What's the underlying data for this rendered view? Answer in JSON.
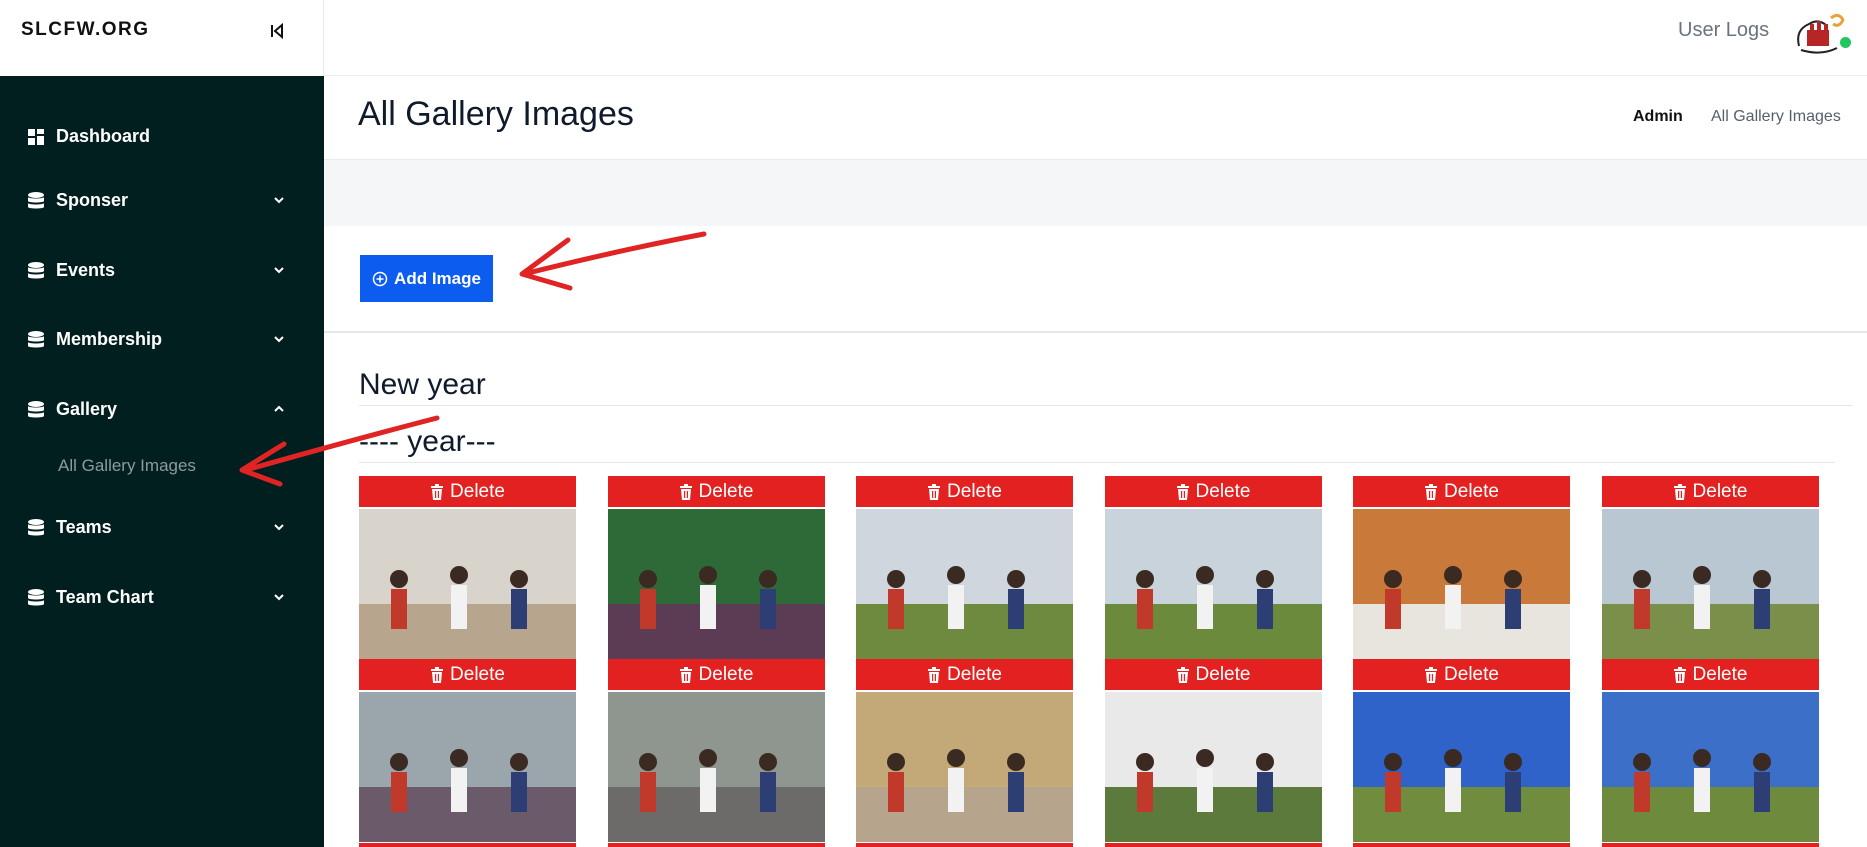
{
  "brand": "SLCFW.ORG",
  "topbar": {
    "user_logs": "User Logs"
  },
  "sidebar": {
    "items": [
      {
        "label": "Dashboard"
      },
      {
        "label": "Sponser"
      },
      {
        "label": "Events"
      },
      {
        "label": "Membership"
      },
      {
        "label": "Gallery"
      },
      {
        "label": "Teams"
      },
      {
        "label": "Team Chart"
      }
    ],
    "gallery_sub": "All Gallery Images"
  },
  "page": {
    "title": "All Gallery Images",
    "breadcrumb": {
      "admin": "Admin",
      "current": "All Gallery Images"
    }
  },
  "toolbar": {
    "add_image": "Add Image"
  },
  "gallery": {
    "section": "New year",
    "subsection": "---- year---",
    "delete_label": "Delete",
    "rows": 2,
    "columns": 6
  },
  "colors": {
    "sidebar": "#011f1e",
    "primary": "#0d5cf0",
    "danger": "#e32121",
    "annotation_arrow": "#e02424"
  },
  "icons": [
    "collapse-icon",
    "dashboard-icon",
    "database-icon",
    "chevron-down-icon",
    "chevron-up-icon",
    "plus-circle-icon",
    "trash-icon"
  ]
}
